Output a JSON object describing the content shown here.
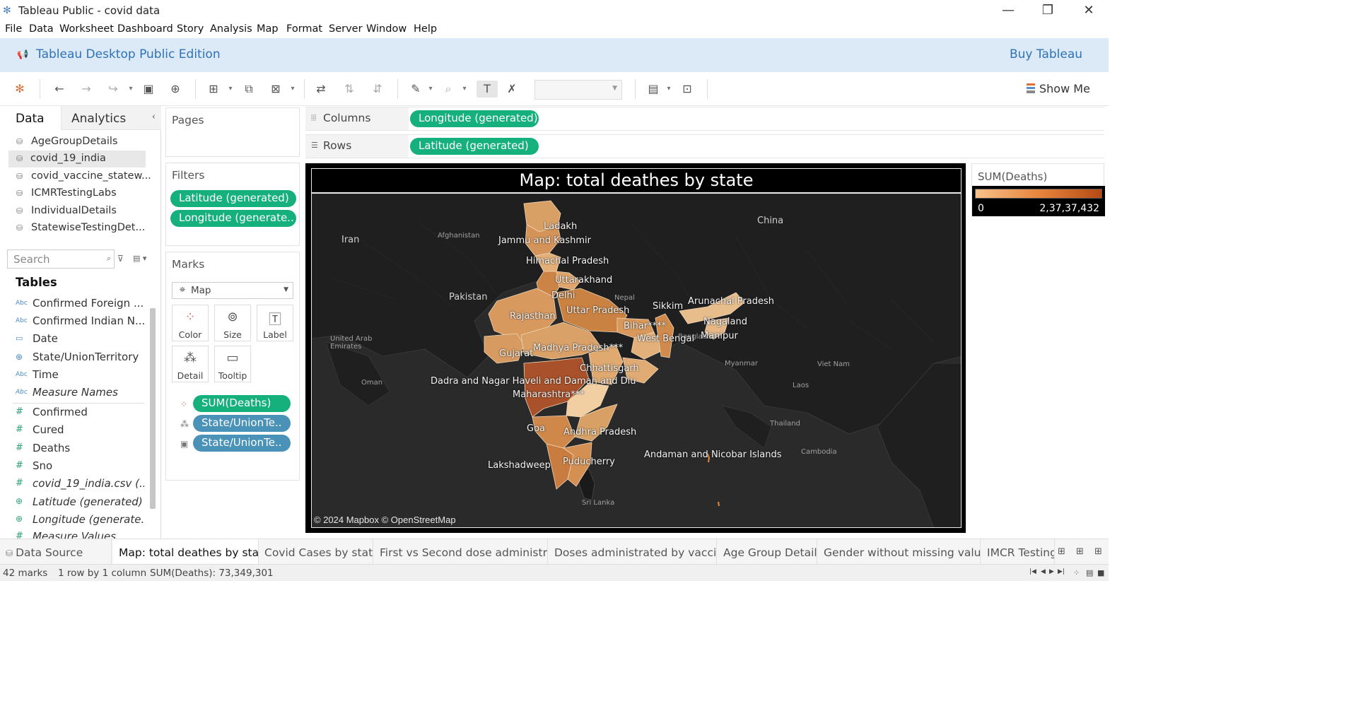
{
  "window": {
    "title": "Tableau Public - covid data",
    "minimize": "—",
    "restore": "❐",
    "close": "✕"
  },
  "menu": [
    "File",
    "Data",
    "Worksheet",
    "Dashboard",
    "Story",
    "Analysis",
    "Map",
    "Format",
    "Server",
    "Window",
    "Help"
  ],
  "banner": {
    "edition": "Tableau Desktop Public Edition",
    "buy": "Buy Tableau"
  },
  "toolbar": {
    "show_me": "Show Me"
  },
  "data_pane": {
    "tab_data": "Data",
    "tab_analytics": "Analytics",
    "data_sources": [
      "AgeGroupDetails",
      "covid_19_india",
      "covid_vaccine_statew...",
      "ICMRTestingLabs",
      "IndividualDetails",
      "StatewiseTestingDet..."
    ],
    "selected_source": "covid_19_india",
    "search_placeholder": "Search",
    "tables_heading": "Tables",
    "dimensions": [
      {
        "name": "Confirmed Foreign ...",
        "type": "Abc"
      },
      {
        "name": "Confirmed Indian N...",
        "type": "Abc"
      },
      {
        "name": "Date",
        "type": "date"
      },
      {
        "name": "State/UnionTerritory",
        "type": "geo"
      },
      {
        "name": "Time",
        "type": "Abc"
      },
      {
        "name": "Measure Names",
        "type": "Abc"
      }
    ],
    "measures": [
      {
        "name": "Confirmed",
        "type": "#"
      },
      {
        "name": "Cured",
        "type": "#"
      },
      {
        "name": "Deaths",
        "type": "#"
      },
      {
        "name": "Sno",
        "type": "#"
      },
      {
        "name": "covid_19_india.csv (...",
        "type": "#"
      },
      {
        "name": "Latitude (generated)",
        "type": "geo"
      },
      {
        "name": "Longitude (generate...",
        "type": "geo"
      },
      {
        "name": "Measure Values",
        "type": "#"
      }
    ]
  },
  "cards": {
    "pages": "Pages",
    "filters": "Filters",
    "filter_pills": [
      "Latitude (generated)",
      "Longitude (generate.."
    ],
    "marks": "Marks",
    "mark_type": "Map",
    "mark_buttons": [
      "Color",
      "Size",
      "Label",
      "Detail",
      "Tooltip"
    ],
    "mark_pills": [
      "SUM(Deaths)",
      "State/UnionTe..",
      "State/UnionTe.."
    ]
  },
  "shelves": {
    "columns_label": "Columns",
    "columns_pill": "Longitude (generated)",
    "rows_label": "Rows",
    "rows_pill": "Latitude (generated)"
  },
  "viz": {
    "title": "Map: total deathes by state",
    "attribution": "© 2024 Mapbox © OpenStreetMap",
    "state_labels": [
      "Ladakh",
      "Jammu and Kashmir",
      "Himachal Pradesh",
      "Uttarakhand",
      "Delhi",
      "Rajasthan",
      "Uttar Pradesh",
      "Sikkim",
      "Arunachal Pradesh",
      "Bihar****",
      "Nagaland",
      "West Bengal",
      "Manipur",
      "Gujarat",
      "Madhya Pradesh***",
      "Chhattisgarh",
      "Dadra and Nagar Haveli and Daman and Diu",
      "Maharashtra***",
      "Goa",
      "Andhra Pradesh",
      "Andaman and Nicobar Islands",
      "Lakshadweep",
      "Puducherry"
    ],
    "country_labels": [
      "Iran",
      "Afghanistan",
      "Pakistan",
      "China",
      "Nepal",
      "United Arab Emirates",
      "Oman",
      "Myanmar",
      "Laos",
      "Viet Nam",
      "Thailand",
      "Cambodia",
      "Sri Lanka",
      "Bangladesh"
    ]
  },
  "legend": {
    "title": "SUM(Deaths)",
    "min": "0",
    "max": "2,37,37,432",
    "colors": [
      "#f6c08a",
      "#e8853d",
      "#b64a15"
    ]
  },
  "sheet_tabs": {
    "data_source": "Data Source",
    "tabs": [
      "Map: total deathes by state",
      "Covid Cases by state",
      "First vs Second dose administra...",
      "Doses administrated by vaccine",
      "Age Group Details",
      "Gender without missing values",
      "IMCR Testing"
    ],
    "active": "Map: total deathes by state"
  },
  "status": {
    "marks": "42 marks",
    "rows_cols": "1 row by 1 column",
    "sum": "SUM(Deaths): 73,349,301"
  },
  "colors": {
    "pill_green": "#15b07c",
    "pill_blue": "#4a92b8",
    "banner_bg": "#dceaf7",
    "banner_text": "#2e72b8"
  }
}
